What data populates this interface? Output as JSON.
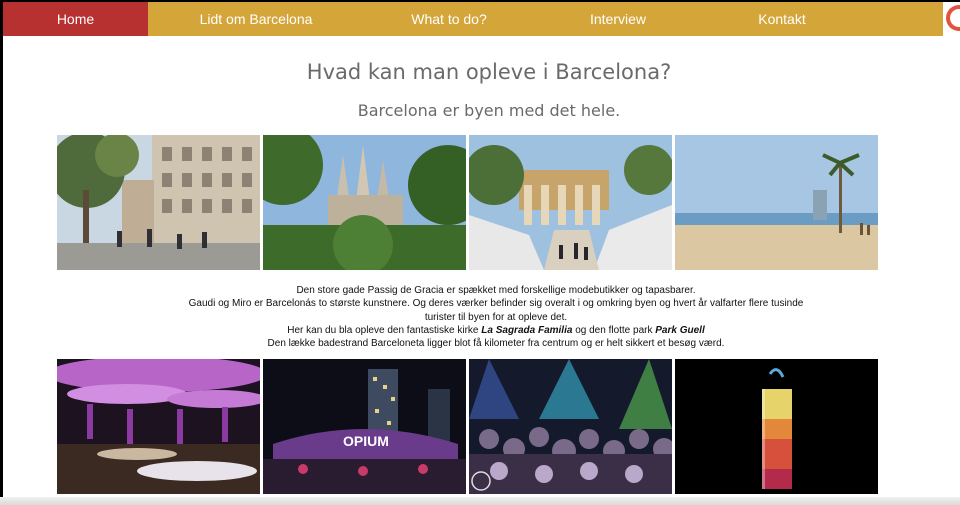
{
  "nav": {
    "items": [
      {
        "label": "Home"
      },
      {
        "label": "Lidt om Barcelona"
      },
      {
        "label": "What to do?"
      },
      {
        "label": "Interview"
      },
      {
        "label": "Kontakt"
      }
    ],
    "active": "Home",
    "logo_icon": "circular-logo-icon"
  },
  "main": {
    "title": "Hvad kan man opleve i Barcelona?",
    "subtitle": "Barcelona er byen med det hele.",
    "text": {
      "line1": "Den store gade Passig de Gracia er spækket med forskellige modebutikker og tapasbarer.",
      "line2": "Gaudi  og Miro er Barcelonás to største kunstnere. Og deres værker befinder sig overalt i og omkring byen og hvert år valfarter flere tusinde turister til byen for at opleve det.",
      "line3_pre": "Her kan du bla opleve den fantastiske kirke ",
      "line3_church": "La Sagrada Familia",
      "line3_mid": " og den flotte park ",
      "line3_park": "Park Guell",
      "line4": "Den lække badestrand Barceloneta ligger blot få kilometer fra centrum og er helt sikkert et besøg værd."
    },
    "photos_top": [
      "street-photo",
      "sagrada-familia-photo",
      "park-guell-photo",
      "beach-photo"
    ],
    "photos_bottom": [
      "lounge-photo",
      "opium-club-photo",
      "nightclub-crowd-photo",
      "cocktail-photo"
    ]
  },
  "colors": {
    "nav_bg": "#d4a63a",
    "nav_active": "#b73131",
    "heading": "#6a6a6a"
  }
}
